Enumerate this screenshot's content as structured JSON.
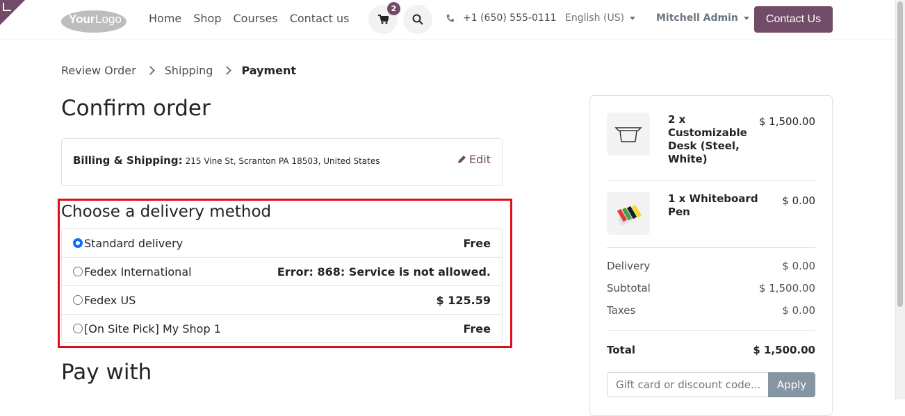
{
  "header": {
    "logo": "YourLogo",
    "nav": [
      "Home",
      "Shop",
      "Courses",
      "Contact us"
    ],
    "cart_count": "2",
    "phone": "+1 (650) 555-0111",
    "language": "English (US)",
    "user": "Mitchell Admin",
    "contact_button": "Contact Us"
  },
  "breadcrumb": {
    "steps": [
      "Review Order",
      "Shipping",
      "Payment"
    ]
  },
  "page_title": "Confirm order",
  "billing": {
    "label": "Billing & Shipping:",
    "address": "215 Vine St, Scranton PA 18503, United States",
    "edit": "Edit"
  },
  "delivery": {
    "title": "Choose a delivery method",
    "methods": [
      {
        "name": "Standard delivery",
        "price": "Free",
        "selected": true
      },
      {
        "name": "Fedex International",
        "price": "Error: 868: Service is not allowed.",
        "selected": false
      },
      {
        "name": "Fedex US",
        "price": "$ 125.59",
        "selected": false
      },
      {
        "name": "[On Site Pick] My Shop 1",
        "price": "Free",
        "selected": false
      }
    ]
  },
  "pay_with_title": "Pay with",
  "summary": {
    "products": [
      {
        "name": "2 x Customizable Desk (Steel, White)",
        "price": "$ 1,500.00",
        "icon": "desk-icon"
      },
      {
        "name": "1 x Whiteboard Pen",
        "price": "$ 0.00",
        "icon": "pens-icon"
      }
    ],
    "delivery_label": "Delivery",
    "delivery_value": "$ 0.00",
    "subtotal_label": "Subtotal",
    "subtotal_value": "$ 1,500.00",
    "taxes_label": "Taxes",
    "taxes_value": "$ 0.00",
    "total_label": "Total",
    "total_value": "$ 1,500.00",
    "promo_placeholder": "Gift card or discount code...",
    "apply_label": "Apply"
  }
}
